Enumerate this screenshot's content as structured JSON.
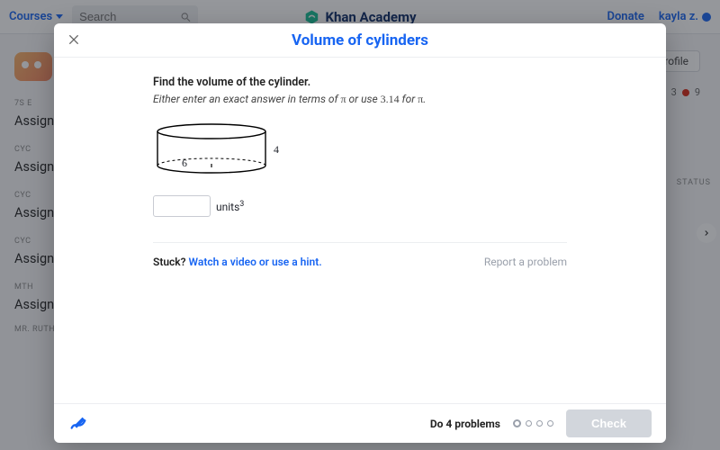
{
  "app": {
    "courses_label": "Courses",
    "search_placeholder": "Search",
    "brand": "Khan Academy",
    "donate": "Donate",
    "user": "kayla z."
  },
  "sidebar": {
    "groups": [
      {
        "label": "7S E",
        "item": "Assignments"
      },
      {
        "label": "CYC",
        "item": "Assignments"
      },
      {
        "label": "CYC",
        "item": "Assignments"
      },
      {
        "label": "CYC",
        "item": "Assignments"
      },
      {
        "label": "MTH",
        "item": "Assignments"
      }
    ],
    "footer_label": "MR. RUTHERFORD'S MATH WORLD"
  },
  "bg_main": {
    "profile_btn": "Edit Profile",
    "energy_a": "3",
    "energy_b": "9",
    "status": "STATUS"
  },
  "modal": {
    "title": "Volume of cylinders",
    "prompt": "Find the volume of the cylinder.",
    "prompt_sub_prefix": "Either enter an exact answer in terms of ",
    "prompt_sub_mid": " or use ",
    "prompt_sub_pi_val": "3.14",
    "prompt_sub_suffix": " for ",
    "pi": "π",
    "period": ".",
    "radius": "6",
    "height": "4",
    "units_label": "units",
    "units_exp": "3",
    "stuck": "Stuck?",
    "help_link": "Watch a video or use a hint.",
    "report": "Report a problem",
    "do_label": "Do 4 problems",
    "check": "Check"
  }
}
